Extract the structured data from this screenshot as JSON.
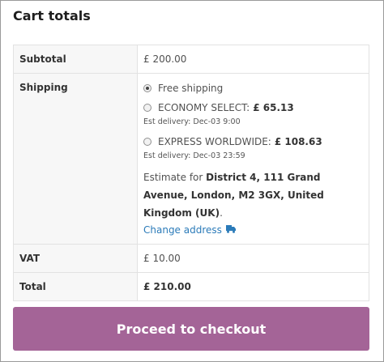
{
  "title": "Cart totals",
  "subtotal": {
    "label": "Subtotal",
    "value": "£ 200.00"
  },
  "shipping": {
    "label": "Shipping",
    "options": [
      {
        "label": "Free shipping",
        "price": "",
        "delivery": "",
        "selected": true
      },
      {
        "label": "ECONOMY SELECT:",
        "price": "£ 65.13",
        "delivery": "Est delivery: Dec-03 9:00",
        "selected": false
      },
      {
        "label": "EXPRESS WORLDWIDE:",
        "price": "£ 108.63",
        "delivery": "Est delivery: Dec-03 23:59",
        "selected": false
      }
    ],
    "estimate_prefix": "Estimate for",
    "destination": "District 4, 111 Grand Avenue, London, M2 3GX, United Kingdom (UK)",
    "estimate_suffix": ".",
    "change_address": "Change address",
    "change_icon": "truck-icon"
  },
  "vat": {
    "label": "VAT",
    "value": "£ 10.00"
  },
  "total": {
    "label": "Total",
    "value": "£ 210.00"
  },
  "checkout_button": "Proceed to checkout",
  "colors": {
    "button": "#a46497",
    "link": "#2b7bb9",
    "header_cell": "#f7f7f7"
  }
}
